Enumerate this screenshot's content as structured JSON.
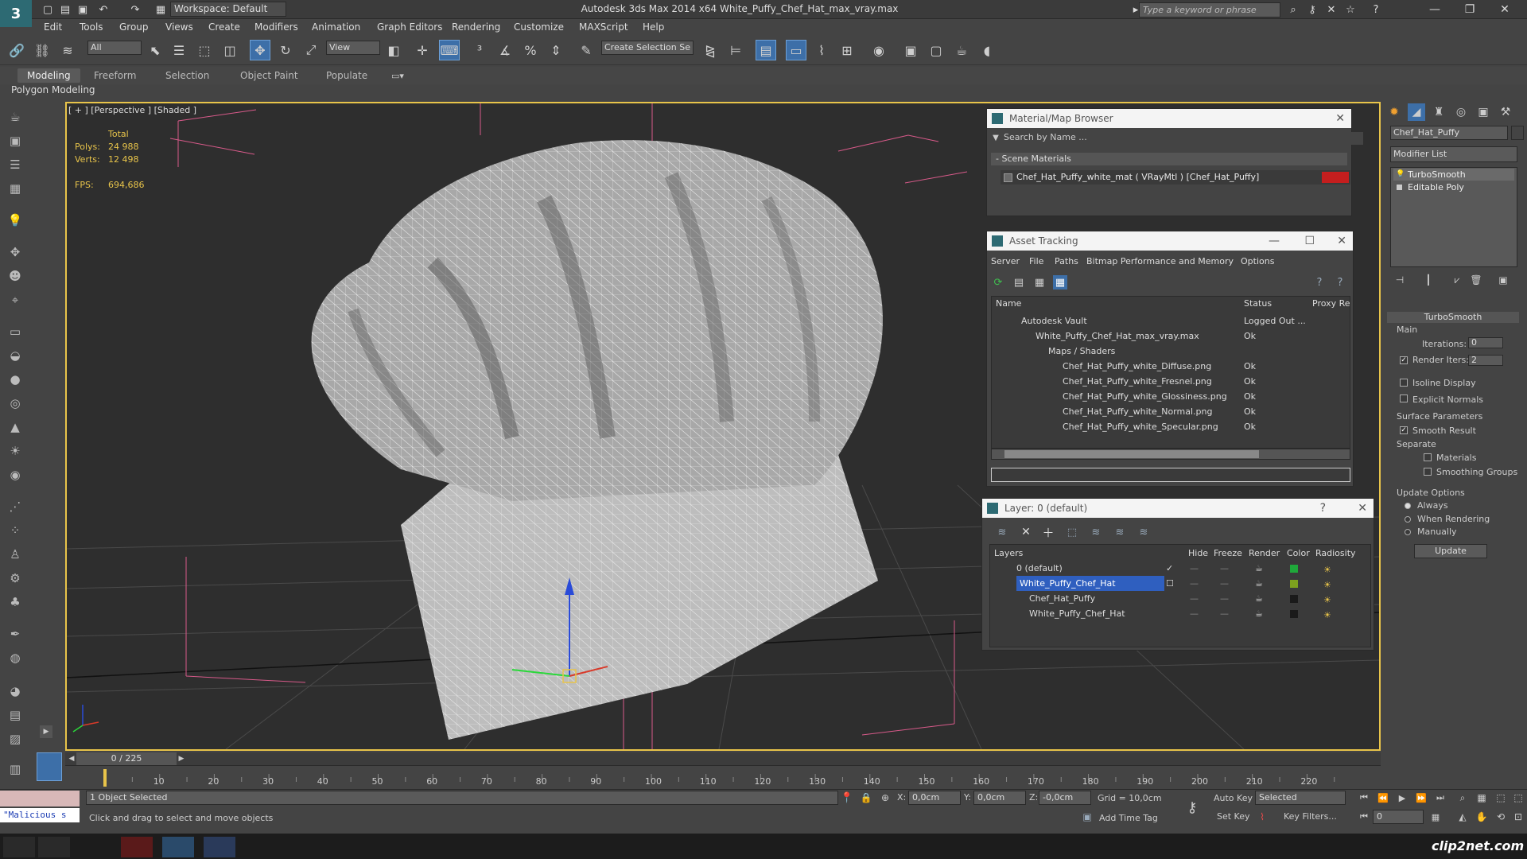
{
  "app": {
    "title": "Autodesk 3ds Max  2014 x64     White_Puffy_Chef_Hat_max_vray.max",
    "workspace": "Workspace: Default",
    "search_placeholder": "Type a keyword or phrase"
  },
  "menu": [
    "Edit",
    "Tools",
    "Group",
    "Views",
    "Create",
    "Modifiers",
    "Animation",
    "Graph Editors",
    "Rendering",
    "Customize",
    "MAXScript",
    "Help"
  ],
  "toolbar": {
    "selection_filter": "All",
    "ref_coord": "View",
    "named_sel_placeholder": "Create Selection Se"
  },
  "ribbon": {
    "tabs": [
      "Modeling",
      "Freeform",
      "Selection",
      "Object Paint",
      "Populate"
    ],
    "panel_label": "Polygon Modeling"
  },
  "viewport": {
    "label": "[ + ] [Perspective ] [Shaded ]",
    "stats": {
      "total_label": "Total",
      "polys_label": "Polys:",
      "polys": "24 988",
      "verts_label": "Verts:",
      "verts": "12 498",
      "fps_label": "FPS:",
      "fps": "694,686"
    }
  },
  "material_browser": {
    "title": "Material/Map Browser",
    "search_placeholder": "Search by Name ...",
    "section": "- Scene Materials",
    "item": "Chef_Hat_Puffy_white_mat  ( VRayMtl ) [Chef_Hat_Puffy]",
    "swatch_color": "#c41e1e"
  },
  "asset_tracking": {
    "title": "Asset Tracking",
    "menu": [
      "Server",
      "File",
      "Paths",
      "Bitmap Performance and Memory",
      "Options"
    ],
    "columns": [
      "Name",
      "Status",
      "Proxy Re"
    ],
    "rows": [
      {
        "name": "Autodesk Vault",
        "status": "Logged Out ..."
      },
      {
        "name": "White_Puffy_Chef_Hat_max_vray.max",
        "status": "Ok"
      },
      {
        "name": "Maps / Shaders",
        "status": ""
      },
      {
        "name": "Chef_Hat_Puffy_white_Diffuse.png",
        "status": "Ok"
      },
      {
        "name": "Chef_Hat_Puffy_white_Fresnel.png",
        "status": "Ok"
      },
      {
        "name": "Chef_Hat_Puffy_white_Glossiness.png",
        "status": "Ok"
      },
      {
        "name": "Chef_Hat_Puffy_white_Normal.png",
        "status": "Ok"
      },
      {
        "name": "Chef_Hat_Puffy_white_Specular.png",
        "status": "Ok"
      }
    ]
  },
  "layers": {
    "title": "Layer: 0 (default)",
    "columns": [
      "Layers",
      "Hide",
      "Freeze",
      "Render",
      "Color",
      "Radiosity"
    ],
    "rows": [
      {
        "name": "0 (default)",
        "color": "#1fa83a"
      },
      {
        "name": "White_Puffy_Chef_Hat",
        "color": "#7da01e"
      },
      {
        "name": "Chef_Hat_Puffy",
        "color": "#1a1a1a"
      },
      {
        "name": "White_Puffy_Chef_Hat",
        "color": "#1a1a1a"
      }
    ]
  },
  "command_panel": {
    "object_name": "Chef_Hat_Puffy",
    "modifier_list": "Modifier List",
    "stack": [
      "TurboSmooth",
      "Editable Poly"
    ],
    "rollout_title": "TurboSmooth",
    "main_label": "Main",
    "iterations_label": "Iterations:",
    "iterations": "0",
    "render_iters_label": "Render Iters:",
    "render_iters": "2",
    "isoline": "Isoline Display",
    "explicit_normals": "Explicit Normals",
    "surface_params": "Surface Parameters",
    "smooth_result": "Smooth Result",
    "separate": "Separate",
    "materials": "Materials",
    "smoothing_groups": "Smoothing Groups",
    "update_options": "Update Options",
    "always": "Always",
    "when_rendering": "When Rendering",
    "manually": "Manually",
    "update_button": "Update"
  },
  "timeline": {
    "frame_counter": "0 / 225",
    "ticks": [
      "10",
      "20",
      "30",
      "40",
      "50",
      "60",
      "70",
      "80",
      "90",
      "100",
      "110",
      "120",
      "130",
      "140",
      "150",
      "160",
      "170",
      "180",
      "190",
      "200",
      "210",
      "220"
    ]
  },
  "status": {
    "maxscript": "\"Malicious s",
    "selected": "1 Object Selected",
    "prompt": "Click and drag to select and move objects",
    "x_label": "X:",
    "x": "0,0cm",
    "y_label": "Y:",
    "y": "0,0cm",
    "z_label": "Z:",
    "z": "-0,0cm",
    "grid": "Grid = 10,0cm",
    "add_time_tag": "Add Time Tag",
    "auto_key": "Auto Key",
    "set_key": "Set Key",
    "key_mode": "Selected",
    "key_filters": "Key Filters...",
    "current_frame": "0"
  },
  "watermark": "clip2net.com"
}
